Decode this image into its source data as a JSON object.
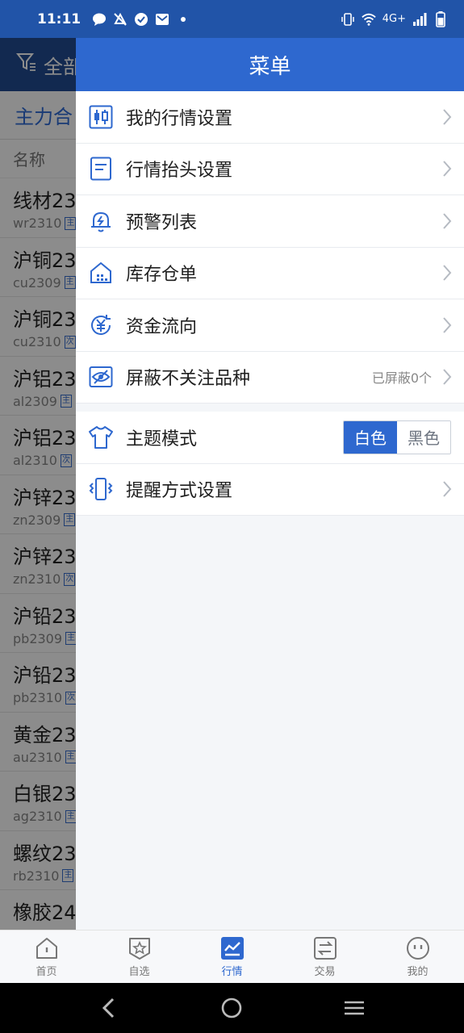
{
  "status_bar": {
    "time": "11:11",
    "network": "4G+"
  },
  "background_page": {
    "header_prefix": "全部",
    "tab": "主力合",
    "column_header": "名称",
    "rows": [
      {
        "name": "线材23",
        "code": "wr2310",
        "tag": "主"
      },
      {
        "name": "沪铜23",
        "code": "cu2309",
        "tag": "主"
      },
      {
        "name": "沪铜23",
        "code": "cu2310",
        "tag": "次"
      },
      {
        "name": "沪铝23",
        "code": "al2309",
        "tag": "主"
      },
      {
        "name": "沪铝23",
        "code": "al2310",
        "tag": "次"
      },
      {
        "name": "沪锌23",
        "code": "zn2309",
        "tag": "主"
      },
      {
        "name": "沪锌23",
        "code": "zn2310",
        "tag": "次"
      },
      {
        "name": "沪铅23",
        "code": "pb2309",
        "tag": "主"
      },
      {
        "name": "沪铅23",
        "code": "pb2310",
        "tag": "次"
      },
      {
        "name": "黄金23",
        "code": "au2310",
        "tag": "主"
      },
      {
        "name": "白银23",
        "code": "ag2310",
        "tag": "主"
      },
      {
        "name": "螺纹23",
        "code": "rb2310",
        "tag": "主"
      },
      {
        "name": "橡胶24",
        "code": "",
        "tag": ""
      }
    ]
  },
  "drawer": {
    "title": "菜单",
    "items": [
      {
        "label": "我的行情设置"
      },
      {
        "label": "行情抬头设置"
      },
      {
        "label": "预警列表"
      },
      {
        "label": "库存仓单"
      },
      {
        "label": "资金流向"
      },
      {
        "label": "屏蔽不关注品种",
        "sub": "已屏蔽0个"
      }
    ],
    "theme": {
      "label": "主题模式",
      "options": [
        "白色",
        "黑色"
      ],
      "selected": "白色"
    },
    "reminder": {
      "label": "提醒方式设置"
    },
    "accent_color": "#2e68cf"
  },
  "bottom_nav": {
    "items": [
      {
        "label": "首页",
        "icon": "home-icon"
      },
      {
        "label": "自选",
        "icon": "star-shield-icon"
      },
      {
        "label": "行情",
        "icon": "chart-icon",
        "active": true
      },
      {
        "label": "交易",
        "icon": "exchange-icon"
      },
      {
        "label": "我的",
        "icon": "face-icon"
      }
    ]
  }
}
